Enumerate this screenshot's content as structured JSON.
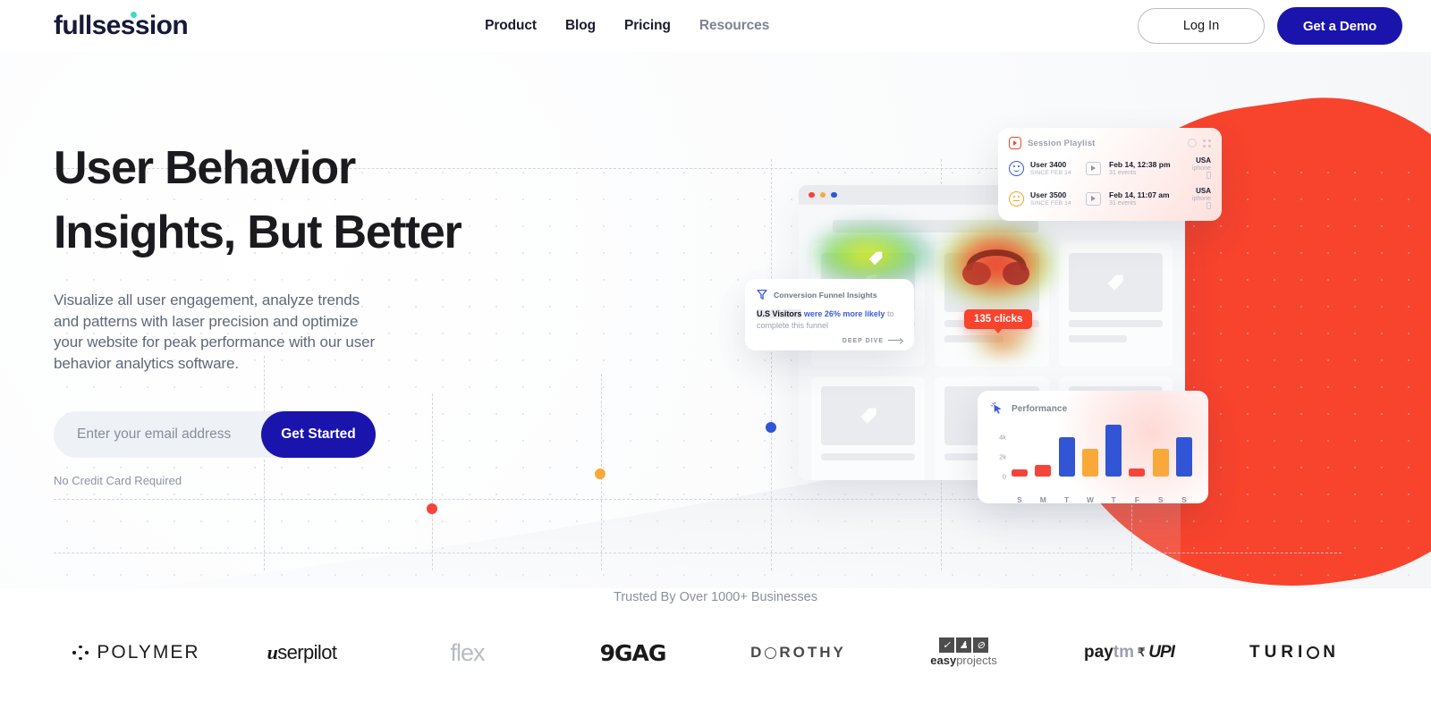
{
  "brand": {
    "name": "fullsession",
    "accent_teal": "#3ddbc0",
    "accent_blue": "#1a14ad",
    "accent_red": "#f8432d"
  },
  "header": {
    "nav": [
      {
        "label": "Product",
        "muted": false
      },
      {
        "label": "Blog",
        "muted": false
      },
      {
        "label": "Pricing",
        "muted": false
      },
      {
        "label": "Resources",
        "muted": true
      }
    ],
    "login_label": "Log In",
    "demo_label": "Get a Demo"
  },
  "hero": {
    "headline_line1": "User Behavior",
    "headline_line2": "Insights, But Better",
    "paragraph": "Visualize all user engagement, analyze trends and patterns with laser precision and optimize your website for peak performance with our user behavior analytics software.",
    "email_placeholder": "Enter your email address",
    "email_value": "",
    "cta_label": "Get Started",
    "disclaimer": "No Credit Card Required"
  },
  "session_playlist": {
    "title": "Session Playlist",
    "icon": "play-square-icon",
    "rows": [
      {
        "user": "User 3400",
        "since": "SINCE FEB 14",
        "mood": "happy",
        "when": "Feb 14, 12:38 pm",
        "events": "31 events",
        "country": "USA",
        "device": "iphone"
      },
      {
        "user": "User 3500",
        "since": "SINCE FEB 14",
        "mood": "neutral",
        "when": "Feb 14, 11:07 am",
        "events": "31 events",
        "country": "USA",
        "device": "iphone"
      }
    ]
  },
  "funnel_card": {
    "title": "Conversion Funnel Insights",
    "icon": "funnel-icon",
    "highlight": "U.S Visitors",
    "emphasis": "were 26% more likely",
    "tail": " to complete this funnel",
    "link": "DEEP DIVE"
  },
  "clicks_badge": {
    "label": "135 clicks"
  },
  "chart_data": {
    "type": "bar",
    "title": "Performance",
    "categories": [
      "S",
      "M",
      "T",
      "W",
      "T",
      "F",
      "S",
      "S"
    ],
    "values": [
      700,
      1150,
      4000,
      2800,
      5200,
      800,
      2800,
      4000
    ],
    "colors": [
      "#f4453a",
      "#f4453a",
      "#3155d4",
      "#f9a93a",
      "#3155d4",
      "#f4453a",
      "#f9a93a",
      "#3155d4"
    ],
    "ytick_labels": [
      "0",
      "2k",
      "4k"
    ],
    "ytick_values": [
      0,
      2000,
      4000
    ],
    "ylim": [
      0,
      5600
    ],
    "xlabel": "",
    "ylabel": "",
    "grid": false,
    "legend": false
  },
  "trusted": {
    "label": "Trusted By Over 1000+ Businesses",
    "logos": [
      {
        "name": "POLYMER"
      },
      {
        "name": "userpilot",
        "mark": "u",
        "rest": "serpilot"
      },
      {
        "name": "flex"
      },
      {
        "name": "9GAG"
      },
      {
        "name": "DOROTHY",
        "pre": "D",
        "post": "ROTHY"
      },
      {
        "name": "easyprojects",
        "bold": "easy",
        "light": "projects",
        "glyphs": [
          "✓",
          "♟",
          "⊘"
        ]
      },
      {
        "name": "Paytm UPI",
        "p1": "pay",
        "p2": "tm",
        "rs": "₹",
        "upi": "UPI"
      },
      {
        "name": "TURION",
        "pre": "TURI",
        "post": "N"
      }
    ]
  }
}
